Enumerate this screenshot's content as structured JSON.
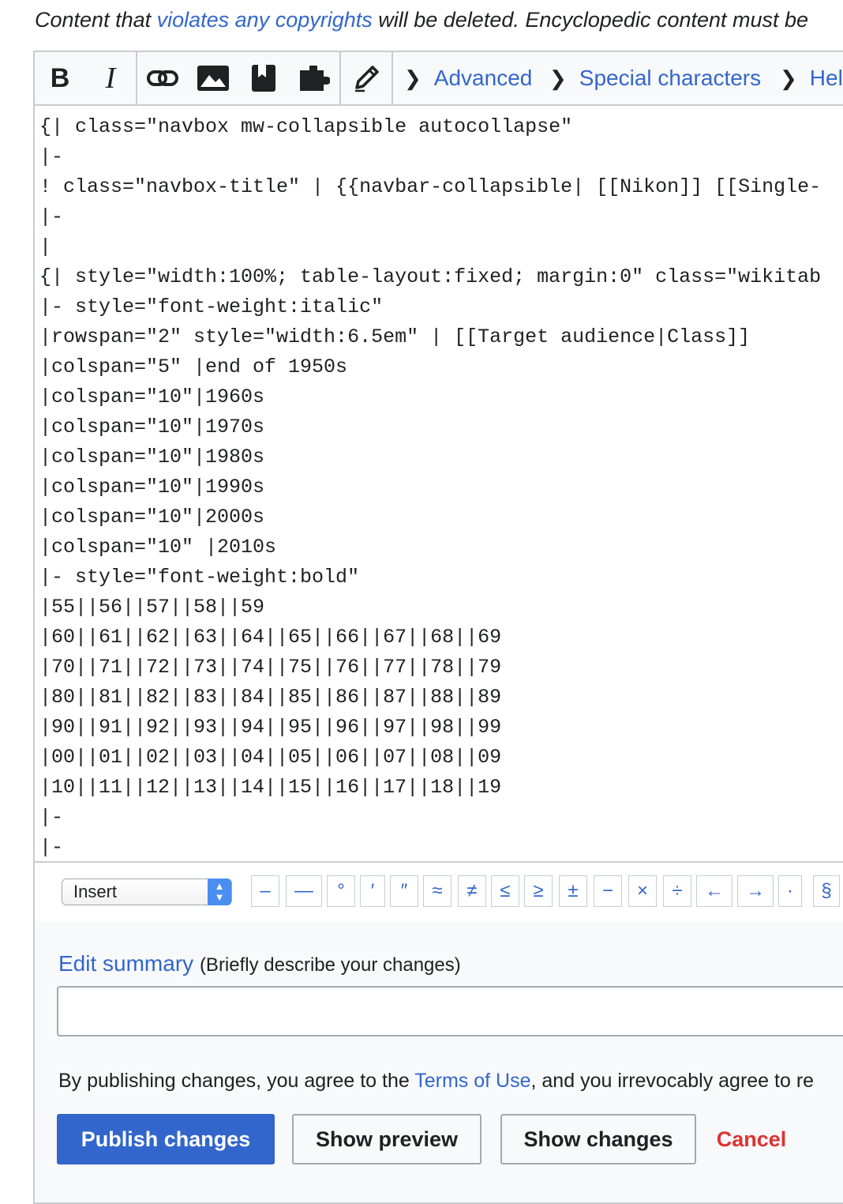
{
  "notice": {
    "before": "Content that ",
    "link": "violates any copyrights",
    "after": " will be deleted. Encyclopedic content must be"
  },
  "toolbar": {
    "bold_label": "B",
    "italic_label": "I",
    "advanced": "Advanced",
    "special_characters": "Special characters",
    "help": "Help"
  },
  "code_lines": [
    "{| class=\"navbox mw-collapsible autocollapse\"",
    "|-",
    "! class=\"navbox-title\" | {{navbar-collapsible| [[Nikon]] [[Single-",
    "|-",
    "|",
    "{| style=\"width:100%; table-layout:fixed; margin:0\" class=\"wikitab",
    "|- style=\"font-weight:italic\"",
    "|rowspan=\"2\" style=\"width:6.5em\" | [[Target audience|Class]]",
    "|colspan=\"5\" |end of 1950s",
    "|colspan=\"10\"|1960s",
    "|colspan=\"10\"|1970s",
    "|colspan=\"10\"|1980s",
    "|colspan=\"10\"|1990s",
    "|colspan=\"10\"|2000s",
    "|colspan=\"10\" |2010s",
    "|- style=\"font-weight:bold\"",
    "|55||56||57||58||59",
    "|60||61||62||63||64||65||66||67||68||69",
    "|70||71||72||73||74||75||76||77||78||79",
    "|80||81||82||83||84||85||86||87||88||89",
    "|90||91||92||93||94||95||96||97||98||99",
    "|00||01||02||03||04||05||06||07||08||09",
    "|10||11||12||13||14||15||16||17||18||19",
    "|-",
    "|-"
  ],
  "special_chars": {
    "insert_label": "Insert",
    "chars": [
      "–",
      "—",
      "°",
      "′",
      "″",
      "≈",
      "≠",
      "≤",
      "≥",
      "±",
      "−",
      "×",
      "÷",
      "←",
      "→",
      "·",
      "§"
    ]
  },
  "summary": {
    "label": "Edit summary",
    "hint": "(Briefly describe your changes)",
    "value": ""
  },
  "legal": {
    "before": "By publishing changes, you agree to the ",
    "link": "Terms of Use",
    "after": ", and you irrevocably agree to re"
  },
  "buttons": {
    "publish": "Publish changes",
    "preview": "Show preview",
    "changes": "Show changes",
    "cancel": "Cancel"
  },
  "colors": {
    "link": "#3366cc",
    "primary": "#3366cc",
    "cancel": "#dd3333",
    "border": "#c8ccd1"
  }
}
